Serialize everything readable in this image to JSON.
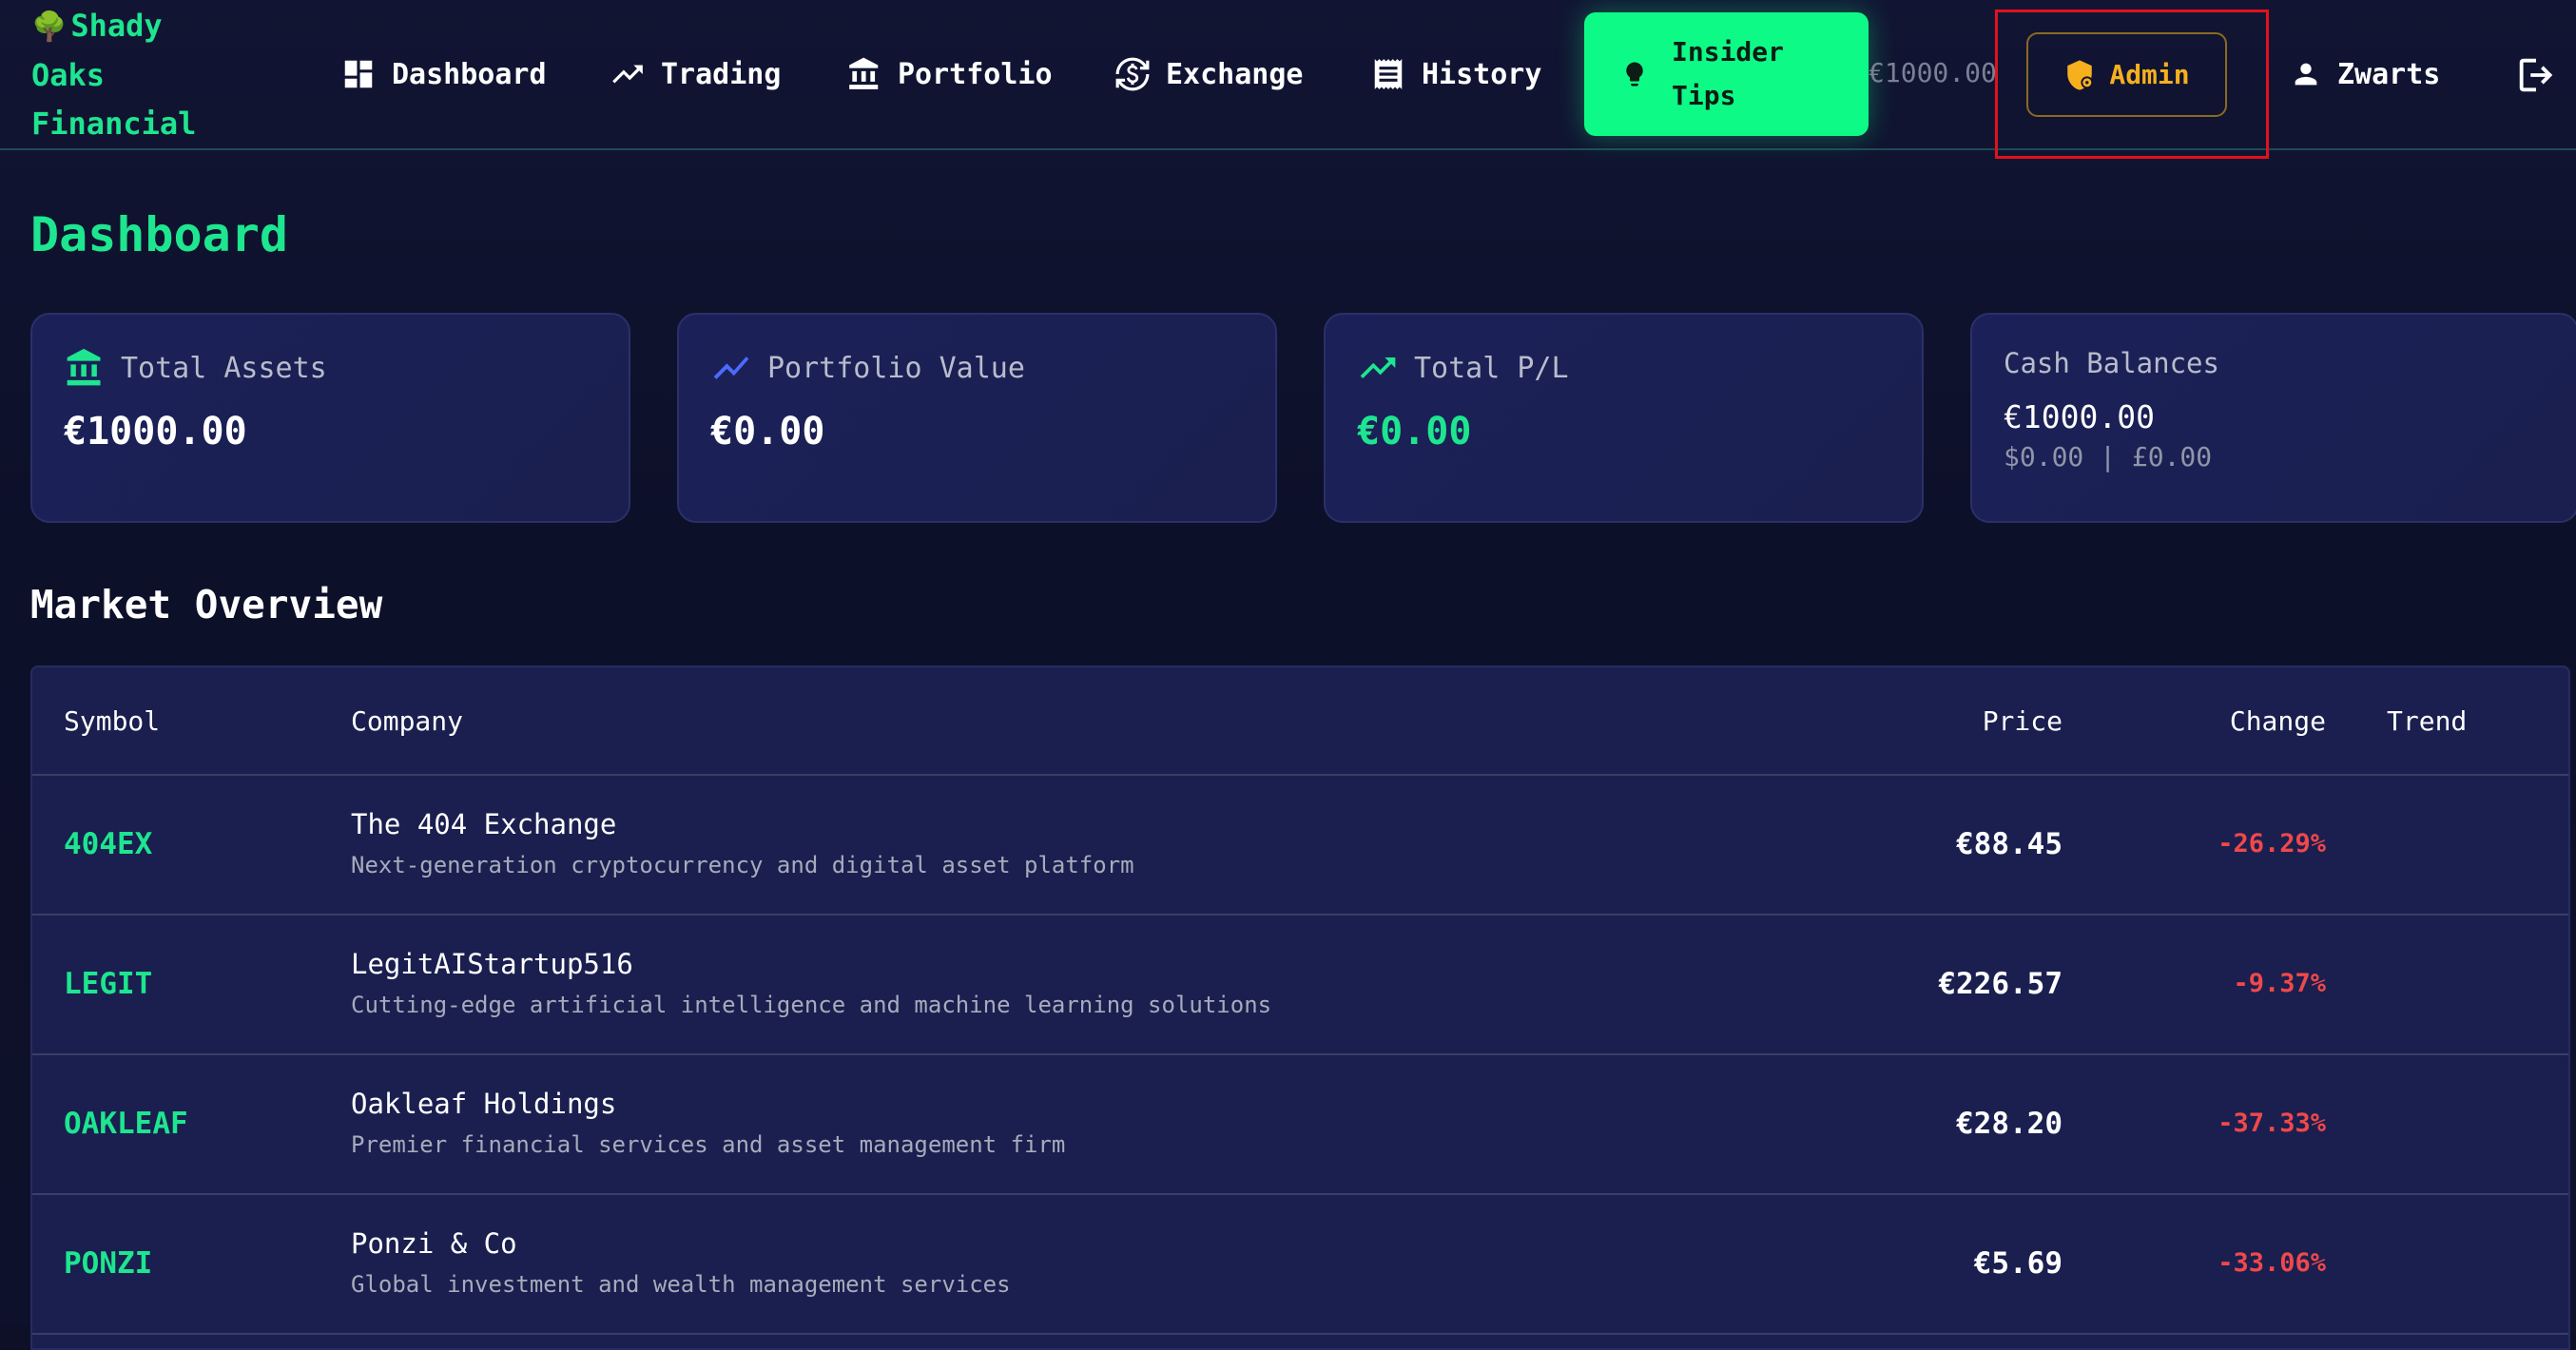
{
  "nav": {
    "brand": "Shady Oaks Financial",
    "items": [
      {
        "label": "Dashboard",
        "icon": "dashboard-icon"
      },
      {
        "label": "Trading",
        "icon": "trending-up-icon"
      },
      {
        "label": "Portfolio",
        "icon": "bank-icon"
      },
      {
        "label": "Exchange",
        "icon": "currency-exchange-icon"
      },
      {
        "label": "History",
        "icon": "receipt-icon"
      }
    ],
    "tips_label": "Insider Tips",
    "balance": "€1000.00",
    "admin_label": "Admin",
    "user_name": "Zwarts"
  },
  "colors": {
    "accent": "#1ee58f",
    "tips_bg": "#0efa87",
    "admin": "#f6b01e",
    "negative": "#f0484b",
    "highlight": "#e0121b",
    "background": "#0d1027",
    "card": "#1b2158"
  },
  "page_title": "Dashboard",
  "cards": {
    "total_assets": {
      "label": "Total Assets",
      "value": "€1000.00",
      "icon": "bank-icon"
    },
    "portfolio_value": {
      "label": "Portfolio Value",
      "value": "€0.00",
      "icon": "chart-line-icon"
    },
    "total_pl": {
      "label": "Total P/L",
      "value": "€0.00",
      "icon": "trending-up-icon"
    },
    "cash": {
      "label": "Cash Balances",
      "main": "€1000.00",
      "sub": "$0.00 | £0.00"
    }
  },
  "market": {
    "title": "Market Overview",
    "columns": {
      "symbol": "Symbol",
      "company": "Company",
      "price": "Price",
      "change": "Change",
      "trend": "Trend"
    },
    "rows": [
      {
        "symbol": "404EX",
        "company": "The 404 Exchange",
        "description": "Next-generation cryptocurrency and digital asset platform",
        "price": "€88.45",
        "change": "-26.29%"
      },
      {
        "symbol": "LEGIT",
        "company": "LegitAIStartup516",
        "description": "Cutting-edge artificial intelligence and machine learning solutions",
        "price": "€226.57",
        "change": "-9.37%"
      },
      {
        "symbol": "OAKLEAF",
        "company": "Oakleaf Holdings",
        "description": "Premier financial services and asset management firm",
        "price": "€28.20",
        "change": "-37.33%"
      },
      {
        "symbol": "PONZI",
        "company": "Ponzi & Co",
        "description": "Global investment and wealth management services",
        "price": "€5.69",
        "change": "-33.06%"
      }
    ]
  }
}
